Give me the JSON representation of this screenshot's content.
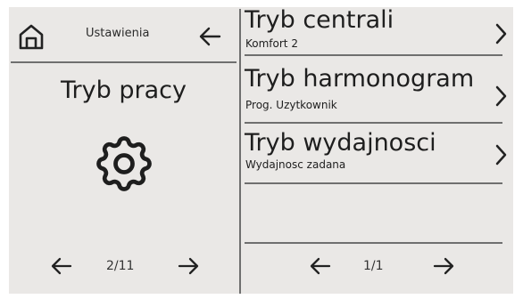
{
  "header": {
    "title": "Ustawienia",
    "home_icon": "home-icon",
    "back_icon": "arrow-left-icon"
  },
  "left_panel": {
    "mode_title": "Tryb pracy",
    "icon": "gear-icon",
    "pagination": {
      "label": "2/11",
      "prev_icon": "arrow-left-icon",
      "next_icon": "arrow-right-icon"
    }
  },
  "right_panel": {
    "items": [
      {
        "title": "Tryb centrali",
        "subtitle": "Komfort 2",
        "icon": "chevron-right-icon"
      },
      {
        "title": "Tryb harmonogram",
        "subtitle": "Prog. Uzytkownik",
        "icon": "chevron-right-icon"
      },
      {
        "title": "Tryb wydajnosci",
        "subtitle": "Wydajnosc zadana",
        "icon": "chevron-right-icon"
      }
    ],
    "pagination": {
      "label": "1/1",
      "prev_icon": "arrow-left-icon",
      "next_icon": "arrow-right-icon"
    }
  },
  "colors": {
    "background": "#eae8e6",
    "text": "#1e1e1e",
    "divider": "#6f6f6f"
  }
}
